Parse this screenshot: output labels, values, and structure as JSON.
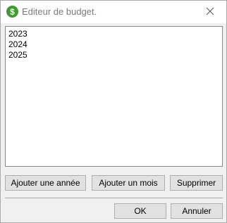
{
  "window": {
    "title": "Editeur de budget.",
    "app_icon": "dollar-icon",
    "close_icon": "close-icon",
    "accent_color": "#3f9b2f"
  },
  "list": {
    "items": [
      "2023",
      "2024",
      "2025"
    ]
  },
  "actions": {
    "add_year_label": "Ajouter une année",
    "add_month_label": "Ajouter un mois",
    "delete_label": "Supprimer"
  },
  "footer": {
    "ok_label": "OK",
    "cancel_label": "Annuler"
  }
}
